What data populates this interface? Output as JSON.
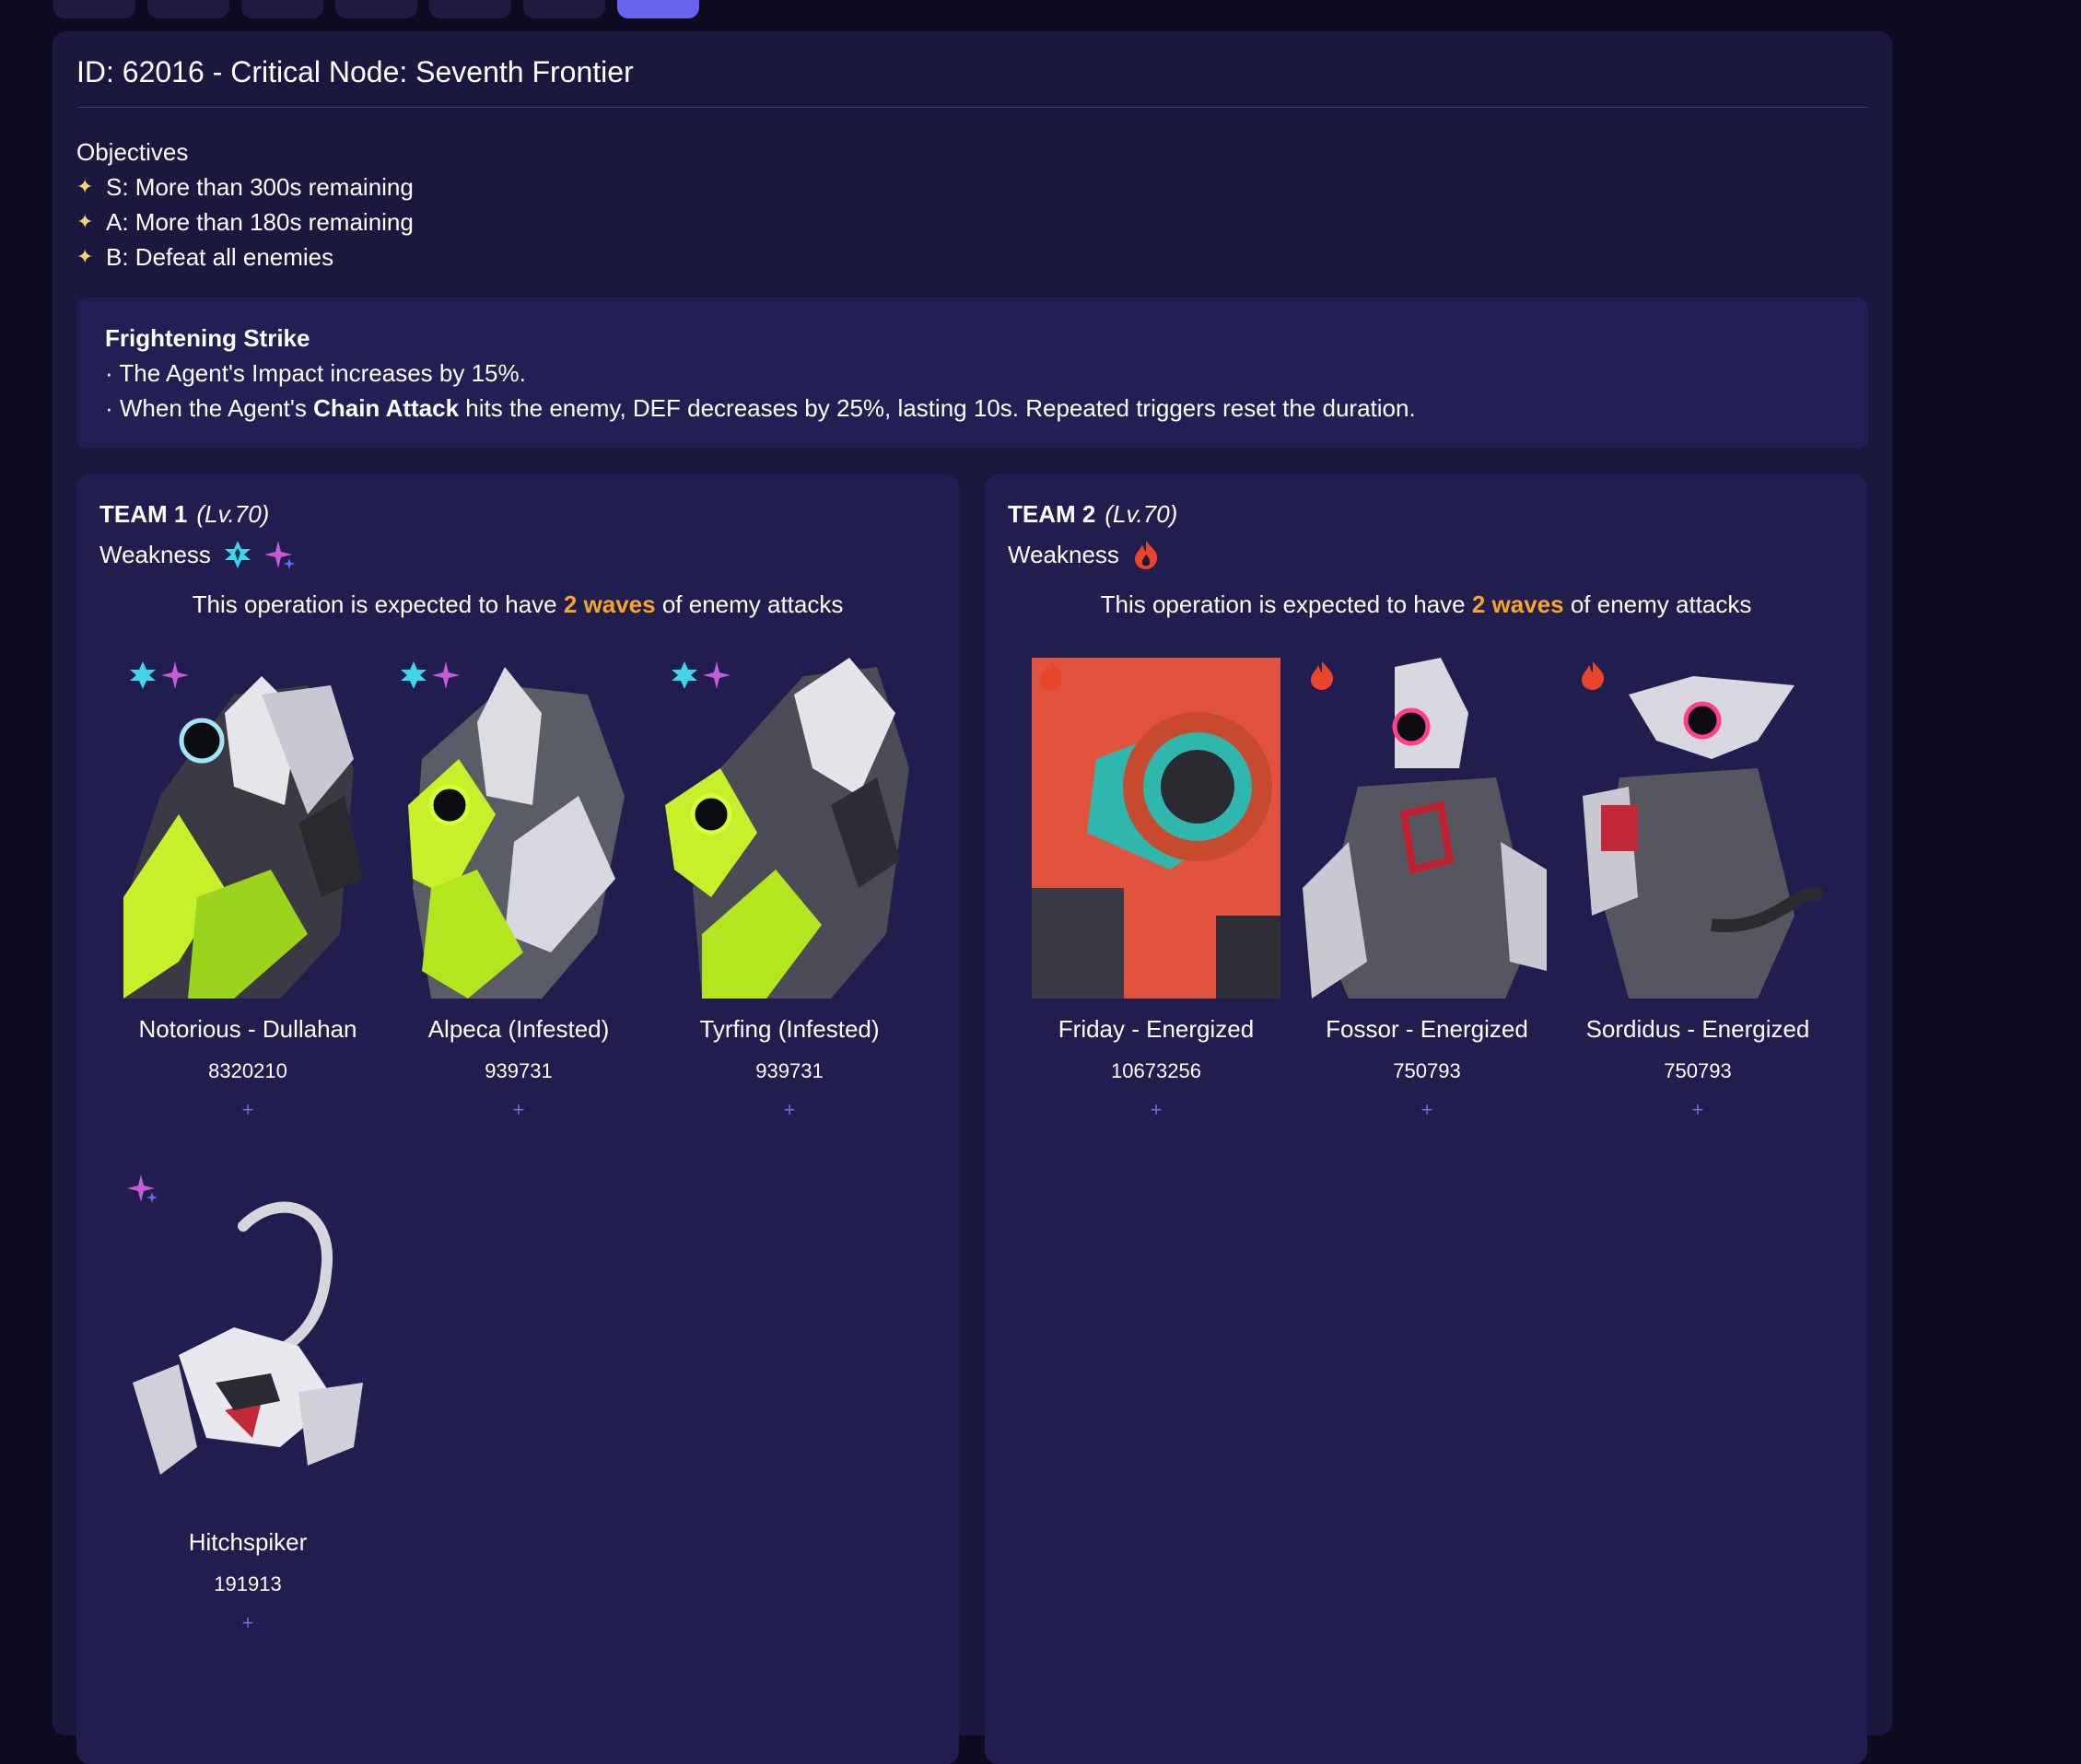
{
  "header": {
    "title": "ID: 62016 - Critical Node: Seventh Frontier"
  },
  "objectives": {
    "heading": "Objectives",
    "items": [
      "S: More than 300s remaining",
      "A: More than 180s remaining",
      "B: Defeat all enemies"
    ]
  },
  "buff": {
    "title": "Frightening Strike",
    "line1": "· The Agent's Impact increases by 15%.",
    "line2_pre": "· When the Agent's ",
    "line2_bold": "Chain Attack",
    "line2_post": " hits the enemy, DEF decreases by 25%, lasting 10s. Repeated triggers reset the duration."
  },
  "teams": [
    {
      "name": "TEAM 1",
      "level": "(Lv.70)",
      "weakness_label": "Weakness",
      "weakness_icons": [
        "ice-icon",
        "ether-icon"
      ],
      "waves_pre": "This operation is expected to have ",
      "waves_hl": "2 waves",
      "waves_post": " of enemy attacks",
      "enemies": [
        {
          "name": "Notorious - Dullahan",
          "hp": "8320210",
          "plus": "+"
        },
        {
          "name": "Alpeca (Infested)",
          "hp": "939731",
          "plus": "+"
        },
        {
          "name": "Tyrfing (Infested)",
          "hp": "939731",
          "plus": "+"
        },
        {
          "name": "Hitchspiker",
          "hp": "191913",
          "plus": "+"
        }
      ]
    },
    {
      "name": "TEAM 2",
      "level": "(Lv.70)",
      "weakness_label": "Weakness",
      "weakness_icons": [
        "fire-icon"
      ],
      "waves_pre": "This operation is expected to have ",
      "waves_hl": "2 waves",
      "waves_post": " of enemy attacks",
      "enemies": [
        {
          "name": "Friday - Energized",
          "hp": "10673256",
          "plus": "+"
        },
        {
          "name": "Fossor - Energized",
          "hp": "750793",
          "plus": "+"
        },
        {
          "name": "Sordidus - Energized",
          "hp": "750793",
          "plus": "+"
        }
      ]
    }
  ],
  "colors": {
    "background": "#0d0b1f",
    "panel": "#1b1840",
    "team_card": "#211d4f",
    "accent": "#6b63ef",
    "highlight": "#f5a623",
    "star": "#f7d36a"
  }
}
